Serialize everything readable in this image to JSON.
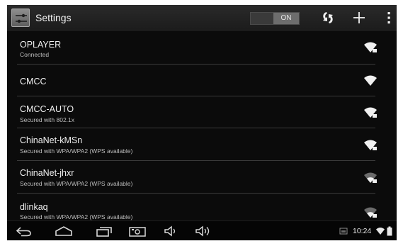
{
  "actionbar": {
    "title": "Settings",
    "wifi_toggle": "ON"
  },
  "networks": [
    {
      "ssid": "OPLAYER",
      "status": "Connected",
      "signal": "strong"
    },
    {
      "ssid": "CMCC",
      "status": "",
      "signal": "strong"
    },
    {
      "ssid": "CMCC-AUTO",
      "status": "Secured with 802.1x",
      "signal": "strong"
    },
    {
      "ssid": "ChinaNet-kMSn",
      "status": "Secured with WPA/WPA2 (WPS available)",
      "signal": "strong"
    },
    {
      "ssid": "ChinaNet-jhxr",
      "status": "Secured with WPA/WPA2 (WPS available)",
      "signal": "weak"
    },
    {
      "ssid": "dlinkaq",
      "status": "Secured with WPA/WPA2 (WPS available)",
      "signal": "weak"
    }
  ],
  "statusbar": {
    "time": "10:24"
  },
  "colors": {
    "background": "#0b0b0b",
    "actionbar": "#222222",
    "divider": "#3a3a3a",
    "text": "#f0f0f0",
    "subtext": "#bdbdbd"
  }
}
